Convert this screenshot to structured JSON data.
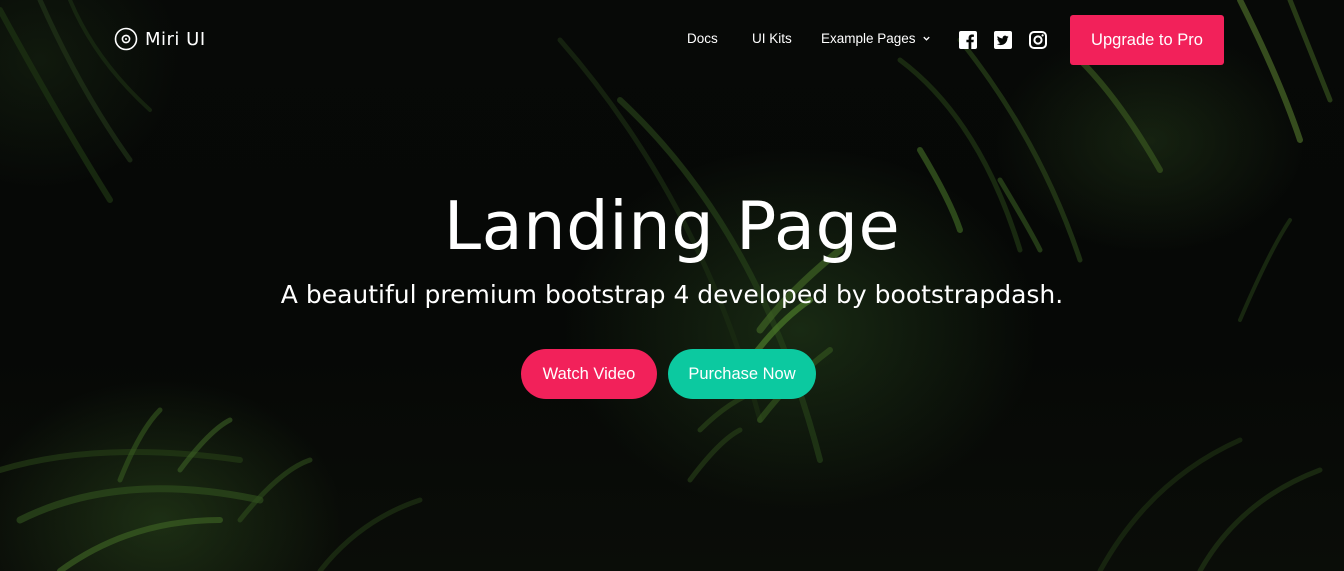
{
  "brand": {
    "name": "Miri UI",
    "icon": "disc-icon"
  },
  "nav": {
    "items": [
      {
        "label": "Docs"
      },
      {
        "label": "UI Kits"
      },
      {
        "label": "Example Pages",
        "icon": "chevron-down-icon"
      }
    ],
    "social": [
      {
        "icon": "facebook-icon"
      },
      {
        "icon": "twitter-icon"
      },
      {
        "icon": "instagram-icon"
      }
    ],
    "upgrade_label": "Upgrade to Pro"
  },
  "hero": {
    "title": "Landing Page",
    "subtitle": "A beautiful premium bootstrap 4 developed by bootstrapdash.",
    "watch_label": "Watch Video",
    "purchase_label": "Purchase Now"
  },
  "colors": {
    "primary": "#f2215a",
    "success": "#0cc9a0",
    "background": "#050705",
    "text": "#ffffff"
  }
}
